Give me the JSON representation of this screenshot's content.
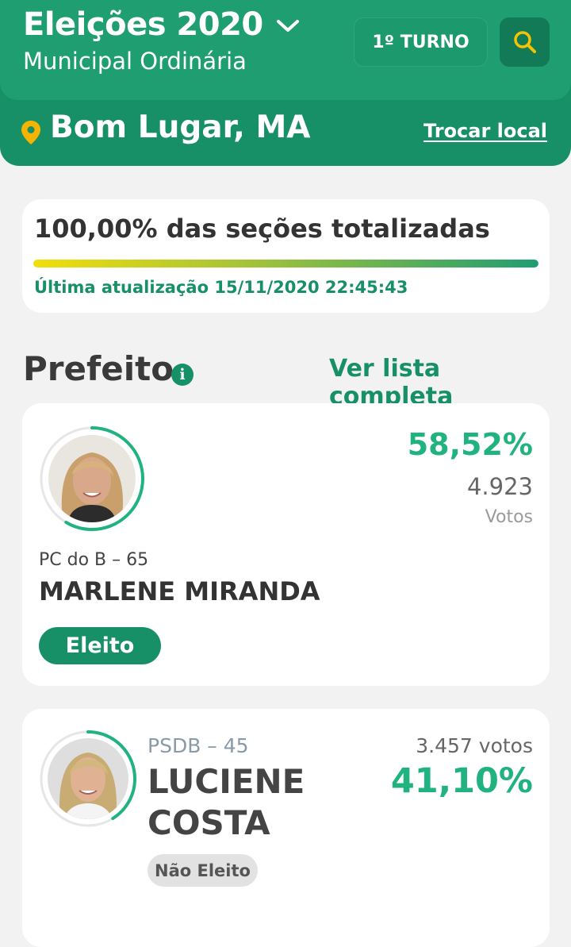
{
  "header": {
    "title": "Eleições 2020",
    "subtitle": "Municipal Ordinária",
    "turno_label": "1º TURNO",
    "location": "Bom Lugar, MA",
    "change_location_label": "Trocar local"
  },
  "status": {
    "totalized_text": "100,00% das seções totalizadas",
    "progress_fraction": 1.0,
    "last_update": "Última atualização 15/11/2020 22:45:43"
  },
  "section": {
    "title": "Prefeito",
    "view_full_list": "Ver lista completa"
  },
  "candidates": [
    {
      "party": "PC do B – 65",
      "name": "MARLENE MIRANDA",
      "percent": "58,52%",
      "votes": "4.923",
      "votes_label": "Votos",
      "status": "Eleito",
      "share": 0.5852
    },
    {
      "party": "PSDB – 45",
      "name": "LUCIENE COSTA",
      "percent": "41,10%",
      "votes": "3.457 votos",
      "status": "Não Eleito",
      "share": 0.411
    }
  ],
  "colors": {
    "primary": "#1f9e72",
    "primary_dark": "#178f67",
    "accent_green": "#20b27f",
    "search_icon": "#f5c400",
    "location_pin": "#f5b400"
  }
}
